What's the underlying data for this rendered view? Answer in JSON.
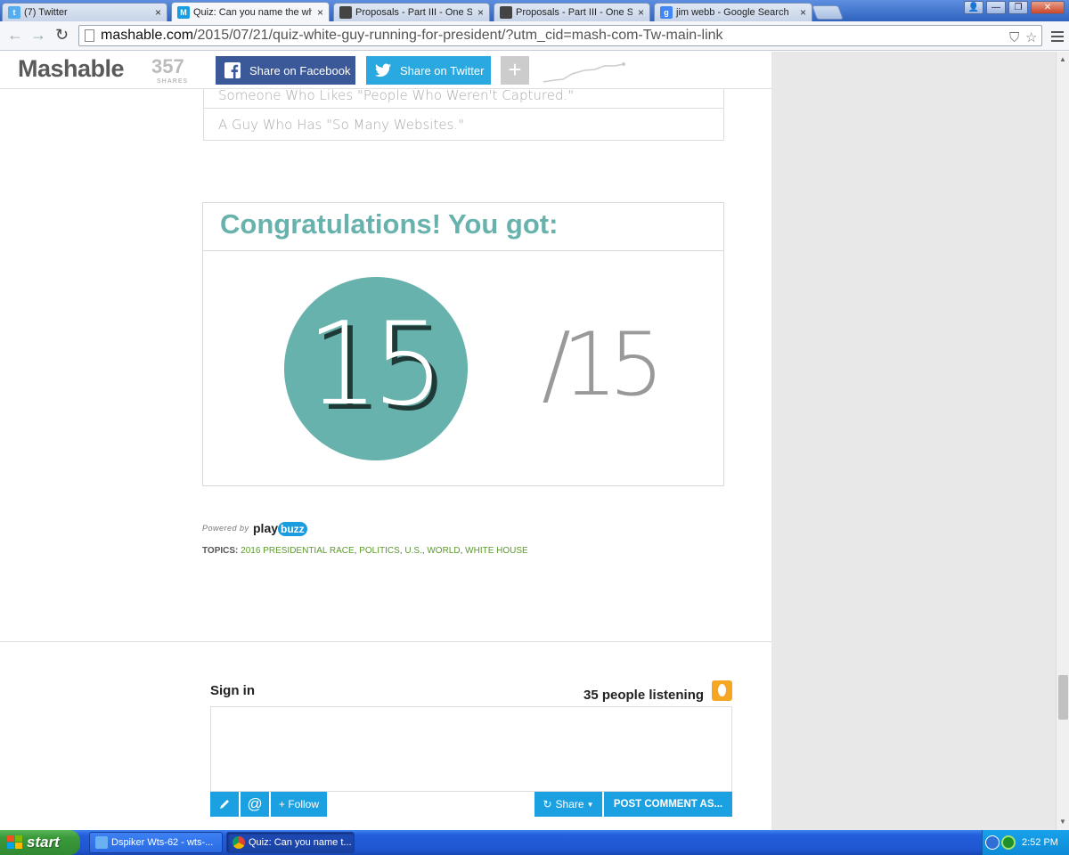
{
  "browser": {
    "tabs": [
      {
        "title": "(7) Twitter",
        "favicon": "twitter-bird-icon",
        "active": false
      },
      {
        "title": "Quiz: Can you name the whi",
        "favicon": "mashable-icon",
        "active": true
      },
      {
        "title": "Proposals - Part III - One Siz",
        "favicon": "cube-icon",
        "active": false
      },
      {
        "title": "Proposals - Part III - One Siz",
        "favicon": "cube-icon",
        "active": false
      },
      {
        "title": "jim webb - Google Search",
        "favicon": "google-icon",
        "active": false
      }
    ],
    "close_glyph": "×",
    "window_buttons": {
      "profile": "👤",
      "minimize": "—",
      "restore": "❐",
      "close": "✕"
    },
    "url_host": "mashable.com",
    "url_path": "/2015/07/21/quiz-white-guy-running-for-president/?utm_cid=mash-com-Tw-main-link"
  },
  "site": {
    "logo": "Mashable",
    "share_count": "357",
    "share_count_label": "SHARES",
    "facebook_label": "Share on Facebook",
    "twitter_label": "Share on Twitter",
    "plus_label": "+"
  },
  "quiz": {
    "options": [
      "Someone Who Likes \"People Who Weren't Captured.\"",
      "A Guy Who Has \"So Many Websites.\""
    ],
    "result_title": "Congratulations! You got:",
    "score": "15",
    "total": "/15"
  },
  "footer": {
    "powered_by": "Powered by",
    "playbuzz_play": "play",
    "playbuzz_buzz": "buzz",
    "topics_label": "TOPICS:",
    "topics": [
      "2016 PRESIDENTIAL RACE",
      "POLITICS",
      "U.S.",
      "WORLD",
      "WHITE HOUSE"
    ]
  },
  "comments": {
    "sign_in": "Sign in",
    "listening": "35 people listening",
    "follow_label": "+ Follow",
    "share_label": "Share",
    "post_label": "POST COMMENT AS..."
  },
  "taskbar": {
    "start_label": "start",
    "tasks": [
      "Dspiker Wts-62 - wts-...",
      "Quiz: Can you name t..."
    ],
    "clock": "2:52 PM"
  },
  "colors": {
    "accent_teal": "#67b2ac",
    "facebook": "#3b5998",
    "twitter": "#2aa9e0",
    "comment_blue": "#1ba1e2",
    "topic_green": "#5a9a2a"
  }
}
